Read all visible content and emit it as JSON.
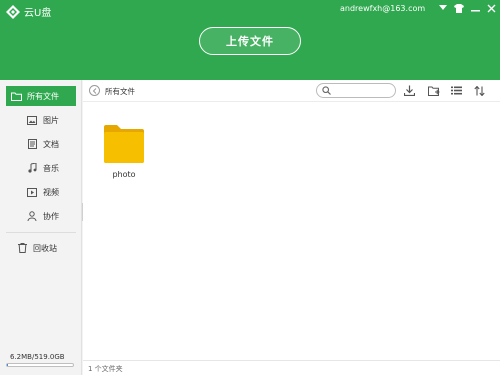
{
  "app": {
    "name": "云U盘"
  },
  "header": {
    "account": "andrewfxh@163.com",
    "upload_label": "上传文件",
    "icons": [
      "account-dropdown-icon",
      "skin-icon",
      "minimize-icon",
      "close-icon"
    ]
  },
  "sidebar": {
    "items": [
      {
        "label": "所有文件",
        "icon": "folder-icon"
      },
      {
        "label": "图片",
        "icon": "image-icon"
      },
      {
        "label": "文档",
        "icon": "document-icon"
      },
      {
        "label": "音乐",
        "icon": "music-icon"
      },
      {
        "label": "视频",
        "icon": "video-icon"
      },
      {
        "label": "协作",
        "icon": "user-icon"
      }
    ],
    "trash_label": "回收站",
    "storage": {
      "text": "6.2MB/519.0GB",
      "used_fraction": 0.0001
    }
  },
  "toolbar": {
    "breadcrumb": "所有文件",
    "search_placeholder": "",
    "icons": [
      "download-icon",
      "new-folder-icon",
      "list-view-icon",
      "sort-icon"
    ]
  },
  "files": [
    {
      "name": "photo",
      "type": "folder"
    }
  ],
  "status": {
    "text": "1 个文件夹"
  },
  "colors": {
    "accent": "#2fa84f",
    "folder": "#f6c000"
  }
}
